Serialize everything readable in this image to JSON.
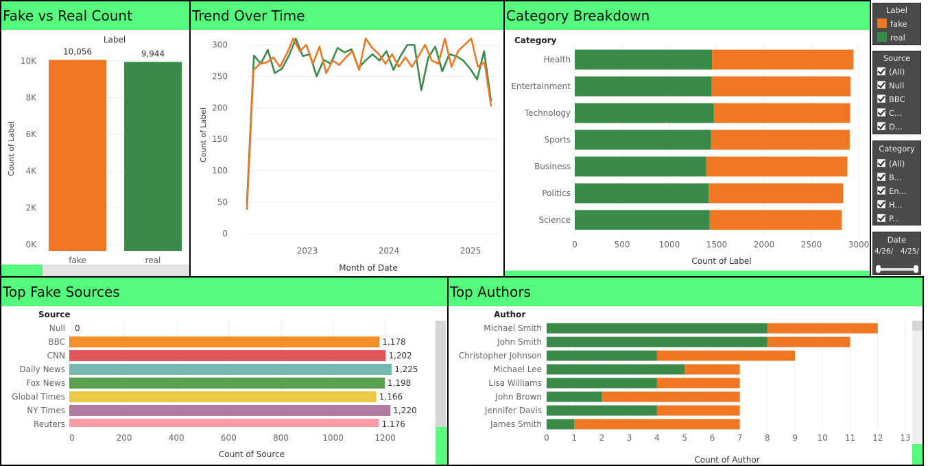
{
  "colors": {
    "fake": "#ef7724",
    "real": "#3a8a4a",
    "header": "#55fb7c"
  },
  "panels": {
    "fake_vs_real": "Fake vs Real Count",
    "trend": "Trend Over Time",
    "category": "Category Breakdown",
    "sources": "Top Fake Sources",
    "authors": "Top Authors"
  },
  "filters": {
    "label": {
      "title": "Label",
      "items": [
        "fake",
        "real"
      ]
    },
    "source": {
      "title": "Source",
      "items": [
        "(All)",
        "Null",
        "BBC",
        "C...",
        "D..."
      ]
    },
    "category": {
      "title": "Category",
      "items": [
        "(All)",
        "B...",
        "En...",
        "H...",
        "P..."
      ]
    },
    "date": {
      "title": "Date",
      "start": "4/26/",
      "end": "4/25/"
    }
  },
  "chart_data": [
    {
      "type": "bar",
      "title": "Fake vs Real Count",
      "legend_title": "Label",
      "categories": [
        "fake",
        "real"
      ],
      "values": [
        10056,
        9944
      ],
      "value_labels": [
        "10,056",
        "9,944"
      ],
      "ylabel": "Count of Label",
      "ylim": [
        0,
        11000
      ],
      "yticks": [
        0,
        2000,
        4000,
        6000,
        8000,
        10000
      ],
      "ytick_labels": [
        "0K",
        "2K",
        "4K",
        "6K",
        "8K",
        "10K"
      ]
    },
    {
      "type": "line",
      "title": "Trend Over Time",
      "xlabel": "Month of Date",
      "ylabel": "Count of Label",
      "ylim": [
        0,
        320
      ],
      "yticks": [
        0,
        50,
        100,
        150,
        200,
        250,
        300
      ],
      "xticks": [
        "2023",
        "2024",
        "2025"
      ],
      "x_start": "2022-04",
      "series": [
        {
          "name": "fake",
          "values": [
            38,
            260,
            270,
            272,
            280,
            265,
            285,
            310,
            290,
            300,
            270,
            297,
            255,
            275,
            268,
            280,
            290,
            260,
            310,
            295,
            285,
            270,
            285,
            265,
            280,
            265,
            282,
            300,
            275,
            270,
            310,
            265,
            290,
            300,
            310,
            265,
            272,
            202
          ]
        },
        {
          "name": "real",
          "values": [
            48,
            283,
            270,
            292,
            255,
            262,
            282,
            310,
            282,
            285,
            250,
            276,
            270,
            295,
            288,
            293,
            263,
            275,
            285,
            275,
            290,
            260,
            282,
            300,
            300,
            228,
            280,
            297,
            258,
            285,
            282,
            275,
            262,
            245,
            290,
            210
          ]
        }
      ]
    },
    {
      "type": "bar",
      "orientation": "horizontal",
      "stacked": true,
      "title": "Category Breakdown",
      "ylabel": "Category",
      "xlabel": "Count of Label",
      "xlim": [
        0,
        3000
      ],
      "xticks": [
        0,
        500,
        1000,
        1500,
        2000,
        2500,
        3000
      ],
      "categories": [
        "Health",
        "Entertainment",
        "Technology",
        "Sports",
        "Business",
        "Politics",
        "Science"
      ],
      "series": [
        {
          "name": "real",
          "values": [
            1450,
            1445,
            1470,
            1440,
            1390,
            1415,
            1425
          ]
        },
        {
          "name": "fake",
          "values": [
            1495,
            1470,
            1440,
            1465,
            1490,
            1420,
            1395
          ]
        }
      ]
    },
    {
      "type": "bar",
      "orientation": "horizontal",
      "title": "Top Fake Sources",
      "ylabel": "Source",
      "xlabel": "Count of Source",
      "xlim": [
        0,
        1390
      ],
      "xticks": [
        0,
        200,
        400,
        600,
        800,
        1000,
        1200
      ],
      "categories": [
        "Null",
        "BBC",
        "CNN",
        "Daily News",
        "Fox News",
        "Global Times",
        "NY Times",
        "Reuters"
      ],
      "values": [
        0,
        1178,
        1202,
        1225,
        1198,
        1166,
        1220,
        1176
      ],
      "value_labels": [
        "0",
        "1,178",
        "1,202",
        "1,225",
        "1,198",
        "1,166",
        "1,220",
        "1,176"
      ],
      "bar_colors": [
        "#f28e2b",
        "#f28e2b",
        "#e15759",
        "#76b7b2",
        "#59a14f",
        "#edc948",
        "#b07aa1",
        "#ff9da7"
      ]
    },
    {
      "type": "bar",
      "orientation": "horizontal",
      "stacked": true,
      "title": "Top Authors",
      "ylabel": "Author",
      "xlabel": "Count of Author",
      "xlim": [
        0,
        13
      ],
      "xticks": [
        0,
        1,
        2,
        3,
        4,
        5,
        6,
        7,
        8,
        9,
        10,
        11,
        12,
        13
      ],
      "categories": [
        "Michael Smith",
        "John Smith",
        "Christopher Johnson",
        "Michael Lee",
        "Lisa Williams",
        "John Brown",
        "Jennifer Davis",
        "James Smith"
      ],
      "series": [
        {
          "name": "real",
          "values": [
            8,
            8,
            4,
            5,
            4,
            2,
            4,
            1
          ]
        },
        {
          "name": "fake",
          "values": [
            4,
            3,
            5,
            2,
            3,
            5,
            3,
            6
          ]
        }
      ]
    }
  ]
}
